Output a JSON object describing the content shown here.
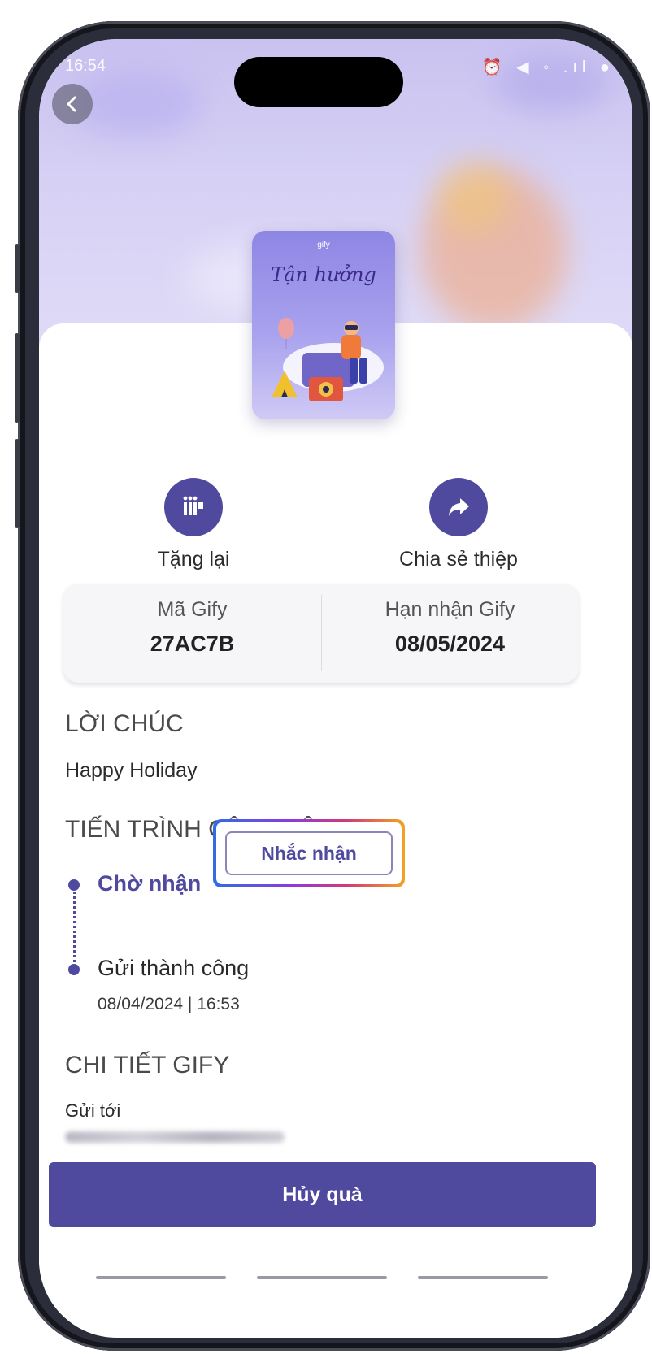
{
  "status_bar": {
    "time": "16:54",
    "icons": "⏰ ◀ ◦ .ıl ●"
  },
  "hero": {
    "card_brand": "gify",
    "card_script": "Tận hưởng"
  },
  "actions": [
    {
      "label": "Tặng lại",
      "icon": "gify-logo-icon"
    },
    {
      "label": "Chia sẻ thiệp",
      "icon": "share-arrow-icon"
    }
  ],
  "info": {
    "code_label": "Mã Gify",
    "code_value": "27AC7B",
    "deadline_label": "Hạn nhận Gify",
    "deadline_value": "08/05/2024"
  },
  "greeting": {
    "heading": "LỜI CHÚC",
    "message": "Happy Holiday"
  },
  "progress": {
    "heading": "TIẾN TRÌNH CẬP NHẬT",
    "steps": [
      {
        "label": "Chờ nhận"
      },
      {
        "label": "Gửi thành công",
        "timestamp": "08/04/2024 | 16:53"
      }
    ],
    "remind_label": "Nhắc nhận"
  },
  "details": {
    "heading": "CHI TIẾT GIFY",
    "sent_to_label": "Gửi tới"
  },
  "footer": {
    "cancel_label": "Hủy quà"
  },
  "colors": {
    "primary": "#4f4a9e",
    "hero_bg": "#d2ccf3"
  }
}
